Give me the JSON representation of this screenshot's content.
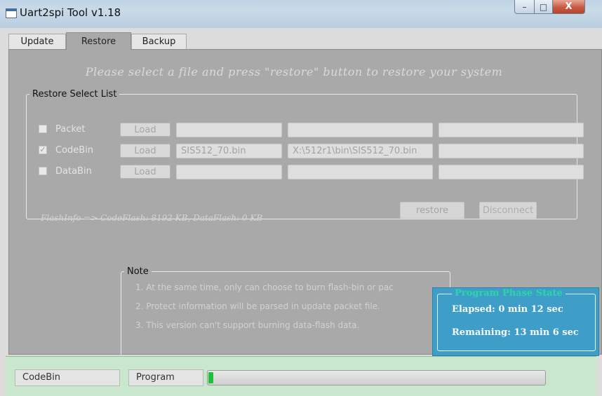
{
  "window": {
    "title": "Uart2spi Tool v1.18",
    "controls": {
      "minimize": "–",
      "maximize": "□",
      "close": "X"
    }
  },
  "tabs": [
    {
      "label": "Update",
      "active": false
    },
    {
      "label": "Restore",
      "active": true
    },
    {
      "label": "Backup",
      "active": false
    }
  ],
  "restore": {
    "instruction": "Please select a file and press \"restore\" button to restore your system",
    "group_title": "Restore Select List",
    "rows": [
      {
        "label": "Packet",
        "checked": false,
        "load_label": "Load",
        "field1": "",
        "field2": "",
        "field3": ""
      },
      {
        "label": "CodeBin",
        "checked": true,
        "load_label": "Load",
        "field1": "SIS512_70.bin",
        "field2": "X:\\512r1\\bin\\SIS512_70.bin",
        "field3": ""
      },
      {
        "label": "DataBin",
        "checked": false,
        "load_label": "Load",
        "field1": "",
        "field2": "",
        "field3": ""
      }
    ],
    "flash_info": "FlashInfo => CodeFlash: 8192 KB, DataFlash: 0 KB",
    "restore_label": "restore",
    "disconnect_label": "Disconnect"
  },
  "note": {
    "title": "Note",
    "lines": [
      "1. At the same time, only can choose to burn flash-bin or pac",
      "2. Protect information will be parsed in update packet file.",
      "3. This version can't support burning data-flash data."
    ]
  },
  "phase": {
    "title": "Program Phase State",
    "elapsed": "Elapsed:  0 min 12 sec",
    "remaining": "Remaining: 13 min  6 sec"
  },
  "status": {
    "left": "CodeBin",
    "mid": "Program",
    "progress_fraction": 0.015,
    "progress_color": "#1fc13a"
  }
}
